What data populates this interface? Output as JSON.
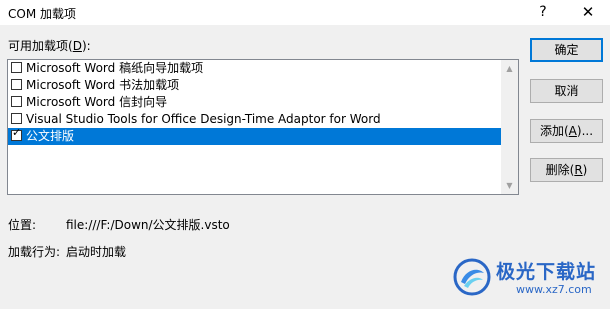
{
  "window": {
    "title": "COM 加载项",
    "help_glyph": "?",
    "close_glyph": "✕"
  },
  "list": {
    "label_prefix": "可用加载项(",
    "label_key": "D",
    "label_suffix": "):",
    "items": [
      {
        "label": "Microsoft Word 稿纸向导加载项",
        "checked": false,
        "selected": false
      },
      {
        "label": "Microsoft Word 书法加载项",
        "checked": false,
        "selected": false
      },
      {
        "label": "Microsoft Word 信封向导",
        "checked": false,
        "selected": false
      },
      {
        "label": "Visual Studio Tools for Office Design-Time Adaptor for Word",
        "checked": false,
        "selected": false
      },
      {
        "label": "公文排版",
        "checked": true,
        "selected": true
      }
    ]
  },
  "buttons": {
    "ok": "确定",
    "cancel": "取消",
    "add_prefix": "添加(",
    "add_key": "A",
    "add_suffix": ")...",
    "remove_prefix": "删除(",
    "remove_key": "R",
    "remove_suffix": ")"
  },
  "info": {
    "location_label": "位置:",
    "location_value": "file:///F:/Down/公文排版.vsto",
    "behavior_label": "加载行为:",
    "behavior_value": "启动时加载"
  },
  "watermark": {
    "name": "极光下载站",
    "url": "www.xz7.com"
  },
  "colors": {
    "selection": "#0078d7",
    "brand": "#2a67c6"
  }
}
